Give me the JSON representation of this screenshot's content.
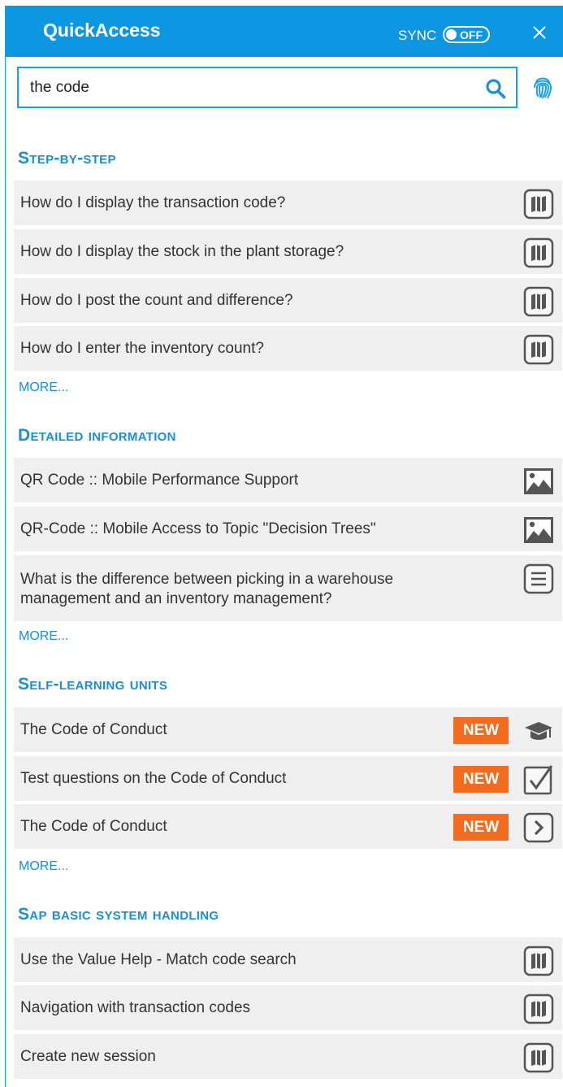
{
  "header": {
    "title": "QuickAccess",
    "sync_label": "SYNC",
    "sync_state": "OFF",
    "close_icon": "close-icon",
    "accent": "#0d96e2"
  },
  "search": {
    "value": "the code",
    "placeholder": "",
    "icon": "search-icon",
    "fingerprint_icon": "fingerprint-icon"
  },
  "sections": [
    {
      "title": "Step-by-step",
      "more": "MORE...",
      "items": [
        {
          "label": "How do I display the transaction code?",
          "icon": "book-icon"
        },
        {
          "label": "How do I display the stock in the plant storage?",
          "icon": "book-icon"
        },
        {
          "label": "How do I post the count and difference?",
          "icon": "book-icon"
        },
        {
          "label": "How do I enter the inventory count?",
          "icon": "book-icon"
        }
      ]
    },
    {
      "title": "Detailed information",
      "more": "MORE...",
      "items": [
        {
          "label": "QR Code :: Mobile Performance Support",
          "icon": "image-icon"
        },
        {
          "label": "QR-Code :: Mobile Access to Topic \"Decision Trees\"",
          "icon": "image-icon"
        },
        {
          "label": "What is the difference between picking in a warehouse management and an inventory management?",
          "icon": "document-icon"
        }
      ]
    },
    {
      "title": "Self-learning units",
      "more": "MORE...",
      "items": [
        {
          "label": "The Code of Conduct",
          "badge": "NEW",
          "icon": "graduation-cap-icon"
        },
        {
          "label": "Test questions on the Code of Conduct",
          "badge": "NEW",
          "icon": "checkbox-icon"
        },
        {
          "label": "The Code of Conduct",
          "badge": "NEW",
          "icon": "chevron-right-icon"
        }
      ]
    },
    {
      "title": "Sap basic system handling",
      "items": [
        {
          "label": "Use the Value Help - Match code search",
          "icon": "book-icon"
        },
        {
          "label": "Navigation with transaction codes",
          "icon": "book-icon"
        },
        {
          "label": "Create new session",
          "icon": "book-icon"
        }
      ]
    }
  ]
}
